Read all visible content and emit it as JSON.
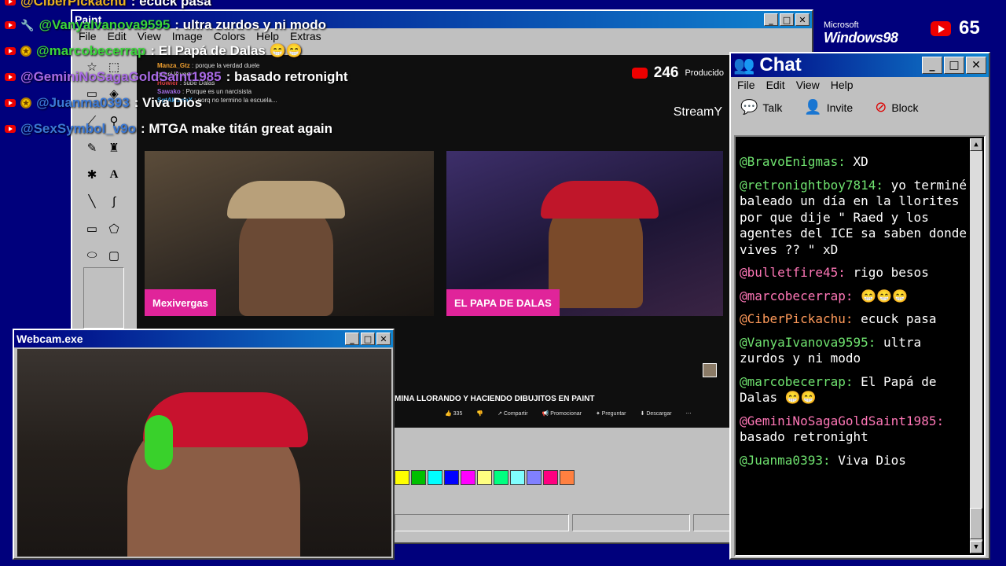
{
  "overlay": {
    "top_partial": {
      "user": "@CiberPickachu",
      "msg": ": ecuck pasa"
    },
    "lines": [
      {
        "user": "@VanyaIvanova9595",
        "msg": ": ultra zurdos y ni modo",
        "color": "#3ad53a",
        "badge": "wrench"
      },
      {
        "user": "@marcobecerrap",
        "msg": ": El Papá de Dalas 😁😁",
        "color": "#3ad53a",
        "badge": "coin"
      },
      {
        "user": "@GeminiNoSagaGoldSaint1985",
        "msg": ": basado retronight",
        "color": "#a96ae6",
        "badge": "none"
      },
      {
        "user": "@Juanma0393",
        "msg": ": Viva Dios",
        "color": "#3a78d5",
        "badge": "coin"
      },
      {
        "user": "@SexSymbol_v9o",
        "msg": ": MTGA make titán great again",
        "color": "#3a78d5",
        "badge": "none"
      }
    ]
  },
  "desktop": {
    "ms_text": "Microsoft",
    "win98_text": "Windows98",
    "yt_count": "65"
  },
  "paint": {
    "title": "Paint",
    "menu": [
      "File",
      "Edit",
      "View",
      "Image",
      "Colors",
      "Help",
      "Extras"
    ],
    "palette": [
      "#ffff00",
      "#00c000",
      "#00ffff",
      "#0000ff",
      "#ff00ff",
      "#ffff80",
      "#00ff80",
      "#80ffff",
      "#8080ff",
      "#ff0080",
      "#ff8040"
    ],
    "stream": {
      "viewers": "246",
      "produced": "Producido",
      "streamy": "StreamY",
      "mini_chat": [
        {
          "u": "Manza_Gtz",
          "m": " : porque la verdad duele",
          "c": "#f0a030"
        },
        {
          "u": "",
          "m": "ganni kruger",
          "c": "#ddd"
        },
        {
          "u": "Howler",
          "m": " : sube Dalas",
          "c": "#e04040"
        },
        {
          "u": "Sawako",
          "m": " : Porque es un narcisista",
          "c": "#a06ae0"
        },
        {
          "u": "SgtAkumaX",
          "m": " : porq no termino la escuela...",
          "c": "#40a0e0"
        }
      ],
      "cam1_label": "Mexivergas",
      "cam2_label": "EL PAPA DE DALAS",
      "video_title": "MINA LLORANDO Y HACIENDO DIBUJITOS EN PAINT",
      "actions": [
        "👍 335",
        "👎",
        "↗ Compartir",
        "📢 Promocionar",
        "✦ Preguntar",
        "⬇ Descargar",
        "⋯"
      ]
    }
  },
  "webcam": {
    "title": "Webcam.exe"
  },
  "chat": {
    "title": "Chat",
    "menu": [
      "File",
      "Edit",
      "View",
      "Help"
    ],
    "toolbar": {
      "talk": "Talk",
      "invite": "Invite",
      "block": "Block"
    },
    "messages": [
      {
        "user": "@BravoEnigmas:",
        "text": " XD",
        "color": "green"
      },
      {
        "user": "@retronightboy7814:",
        "text": " yo terminé baleado un día en la llorites por que dije \" Raed y los agentes del ICE sa saben donde vives ?? \" xD",
        "color": "green"
      },
      {
        "user": "@bulletfire45:",
        "text": " rigo besos",
        "color": "pink"
      },
      {
        "user": "@marcobecerrap:",
        "text": " 😁😁😁",
        "color": "pink"
      },
      {
        "user": "@CiberPickachu:",
        "text": " ecuck pasa",
        "color": "orange"
      },
      {
        "user": "@VanyaIvanova9595:",
        "text": " ultra zurdos y ni modo",
        "color": "green"
      },
      {
        "user": "@marcobecerrap:",
        "text": " El Papá de Dalas 😁😁",
        "color": "green"
      },
      {
        "user": "@GeminiNoSagaGoldSaint1985:",
        "text": " basado retronight",
        "color": "pink"
      },
      {
        "user": "@Juanma0393:",
        "text": " Viva Dios",
        "color": "green"
      }
    ]
  }
}
